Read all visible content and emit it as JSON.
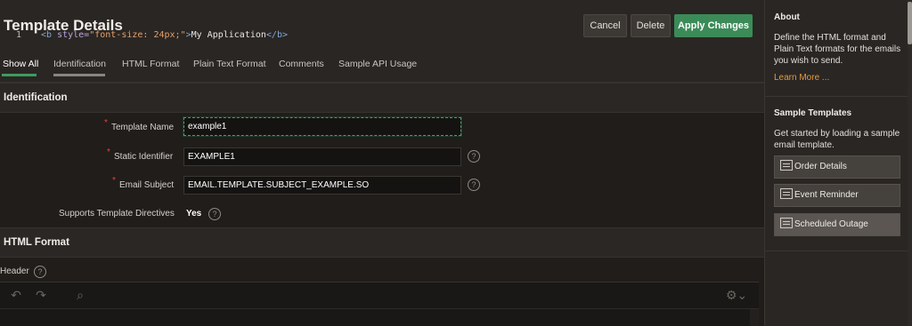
{
  "header": {
    "title": "Template Details",
    "cancel_label": "Cancel",
    "delete_label": "Delete",
    "apply_label": "Apply Changes"
  },
  "tabs": [
    {
      "label": "Show All",
      "active": true
    },
    {
      "label": "Identification"
    },
    {
      "label": "HTML Format"
    },
    {
      "label": "Plain Text Format"
    },
    {
      "label": "Comments"
    },
    {
      "label": "Sample API Usage"
    }
  ],
  "identification": {
    "section_title": "Identification",
    "template_name_label": "Template Name",
    "template_name_value": "example1",
    "static_identifier_label": "Static Identifier",
    "static_identifier_value": "EXAMPLE1",
    "email_subject_label": "Email Subject",
    "email_subject_value": "EMAIL.TEMPLATE.SUBJECT_EXAMPLE.SO",
    "directives_label": "Supports Template Directives",
    "directives_value": "Yes",
    "required_marker": "*"
  },
  "html_format": {
    "section_title": "HTML Format",
    "header_label": "Header",
    "editor": {
      "line_number": "1",
      "code": {
        "open_tag": "<b",
        "attr": "style=",
        "value": "\"font-size: 24px;\"",
        "close_bracket": ">",
        "text": "My Application",
        "end_tag": "</b>"
      }
    }
  },
  "sidebar": {
    "about_title": "About",
    "about_text": "Define the HTML format and Plain Text formats for the emails you wish to send.",
    "learn_more": "Learn More ...",
    "sample_title": "Sample Templates",
    "sample_text": "Get started by loading a sample email template.",
    "templates": [
      "Order Details",
      "Event Reminder",
      "Scheduled Outage"
    ]
  },
  "icons": {
    "help": "?",
    "undo": "↶",
    "redo": "↷",
    "search": "⌕",
    "settings": "⚙⌄"
  },
  "colors": {
    "accent_green": "#3b8b58",
    "link_orange": "#e59b42",
    "required_red": "#e0463c"
  }
}
